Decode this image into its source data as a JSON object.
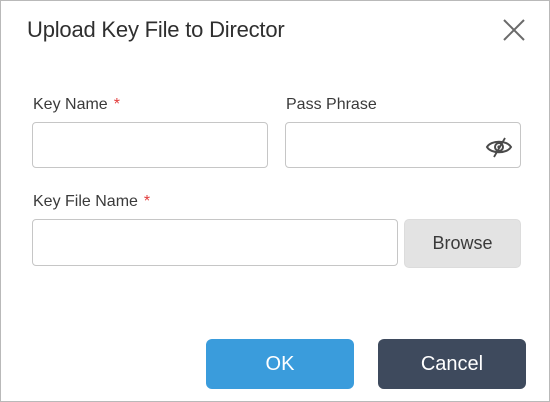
{
  "dialog": {
    "title": "Upload Key File to Director",
    "close_icon": "close-icon"
  },
  "form": {
    "key_name": {
      "label": "Key Name",
      "required_mark": "*",
      "value": "",
      "placeholder": ""
    },
    "pass_phrase": {
      "label": "Pass Phrase",
      "value": "",
      "placeholder": "",
      "visibility_icon": "eye-slash-icon"
    },
    "key_file_name": {
      "label": "Key File Name",
      "required_mark": "*",
      "value": "",
      "placeholder": ""
    },
    "browse_label": "Browse"
  },
  "footer": {
    "ok_label": "OK",
    "cancel_label": "Cancel"
  },
  "colors": {
    "required": "#e23b3b",
    "ok_button": "#3a9cdc",
    "cancel_button": "#3e4a5d",
    "browse_button": "#e3e3e3"
  }
}
